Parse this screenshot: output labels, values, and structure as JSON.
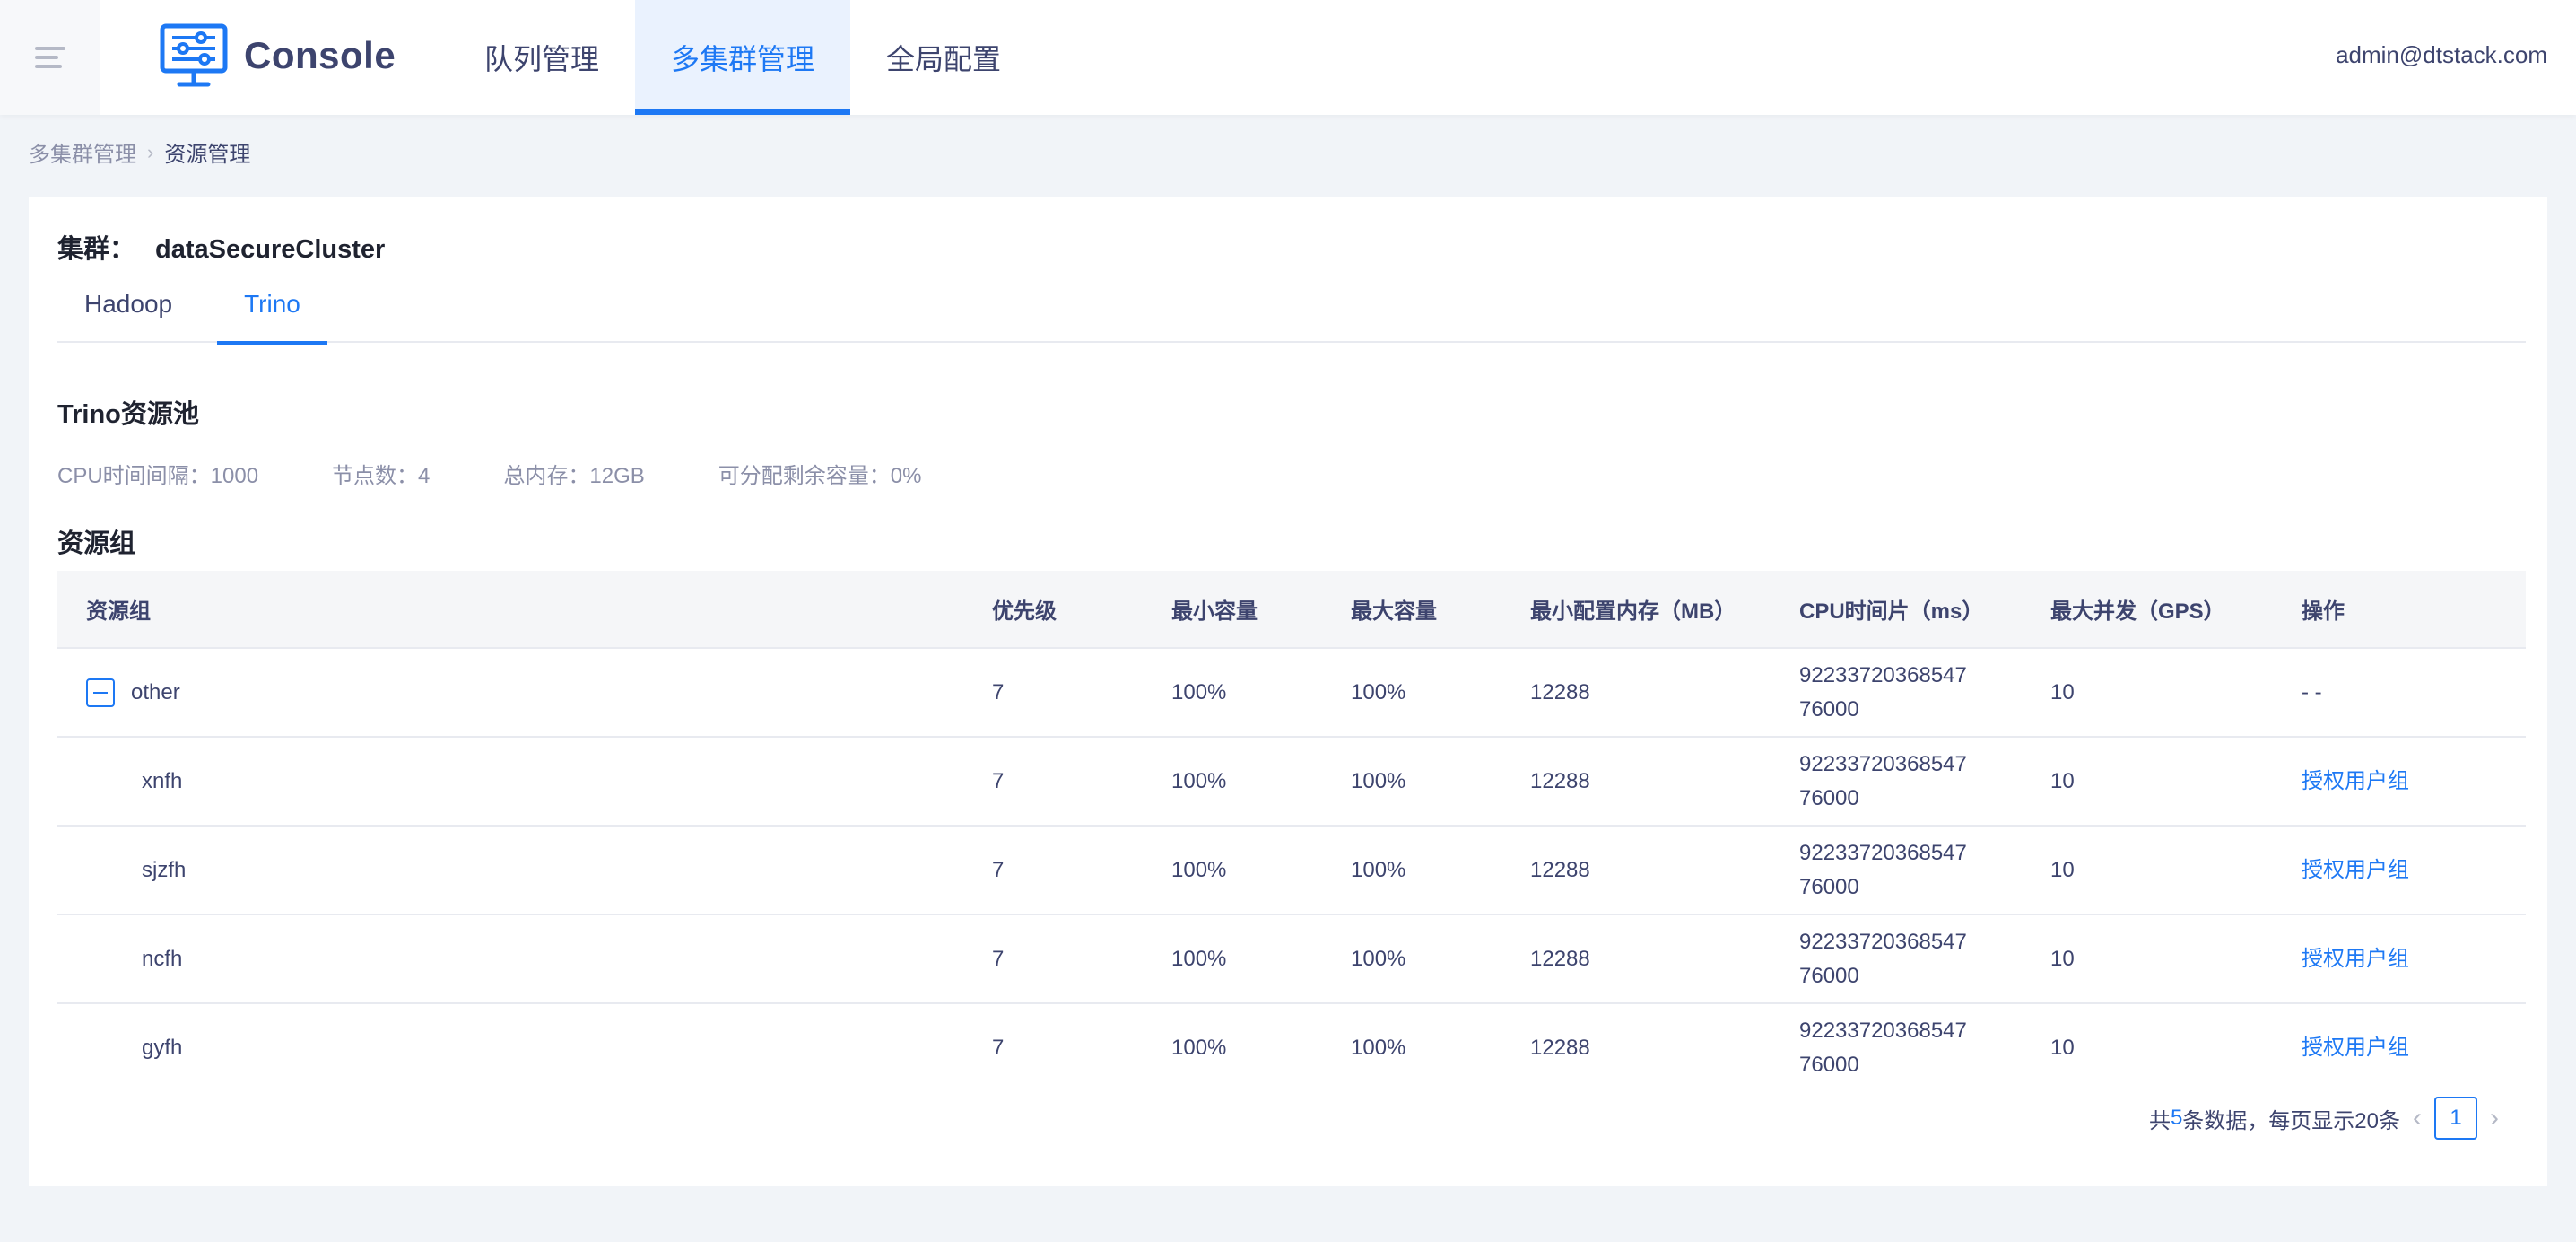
{
  "header": {
    "brand": "Console",
    "nav": [
      "队列管理",
      "多集群管理",
      "全局配置"
    ],
    "active_nav": "多集群管理",
    "user": "admin@dtstack.com"
  },
  "breadcrumb": {
    "prev": "多集群管理",
    "current": "资源管理"
  },
  "cluster": {
    "label": "集群：",
    "name": "dataSecureCluster"
  },
  "tabs": [
    "Hadoop",
    "Trino"
  ],
  "active_tab": "Trino",
  "pool": {
    "title": "Trino资源池",
    "stats": [
      "CPU时间间隔：1000",
      "节点数：4",
      "总内存：12GB",
      "可分配剩余容量：0%"
    ]
  },
  "groups": {
    "title": "资源组",
    "columns": [
      "资源组",
      "优先级",
      "最小容量",
      "最大容量",
      "最小配置内存（MB）",
      "CPU时间片（ms）",
      "最大并发（GPS）",
      "操作"
    ],
    "rows": [
      {
        "name": "other",
        "priority": "7",
        "min": "100%",
        "max": "100%",
        "mem": "12288",
        "cpu_l1": "92233720368547",
        "cpu_l2": "76000",
        "conc": "10",
        "op": "- -"
      },
      {
        "name": "xnfh",
        "priority": "7",
        "min": "100%",
        "max": "100%",
        "mem": "12288",
        "cpu_l1": "92233720368547",
        "cpu_l2": "76000",
        "conc": "10",
        "op": "授权用户组"
      },
      {
        "name": "sjzfh",
        "priority": "7",
        "min": "100%",
        "max": "100%",
        "mem": "12288",
        "cpu_l1": "92233720368547",
        "cpu_l2": "76000",
        "conc": "10",
        "op": "授权用户组"
      },
      {
        "name": "ncfh",
        "priority": "7",
        "min": "100%",
        "max": "100%",
        "mem": "12288",
        "cpu_l1": "92233720368547",
        "cpu_l2": "76000",
        "conc": "10",
        "op": "授权用户组"
      },
      {
        "name": "gyfh",
        "priority": "7",
        "min": "100%",
        "max": "100%",
        "mem": "12288",
        "cpu_l1": "92233720368547",
        "cpu_l2": "76000",
        "conc": "10",
        "op": "授权用户组"
      }
    ]
  },
  "pagination": {
    "prefix": "共",
    "total": "5",
    "suffix": "条数据，每页显示20条",
    "current_page": "1"
  },
  "colors": {
    "primary": "#1d78f4",
    "text": "#3d446e",
    "muted": "#8b8fa8",
    "background": "#f1f4f8"
  },
  "icons": {
    "menu": "menu-toggle-icon",
    "logo": "console-logo-icon",
    "breadcrumb_sep": "chevron-right-icon",
    "expand": "collapse-minus-icon",
    "prev": "chevron-left-icon",
    "next": "chevron-right-icon"
  }
}
